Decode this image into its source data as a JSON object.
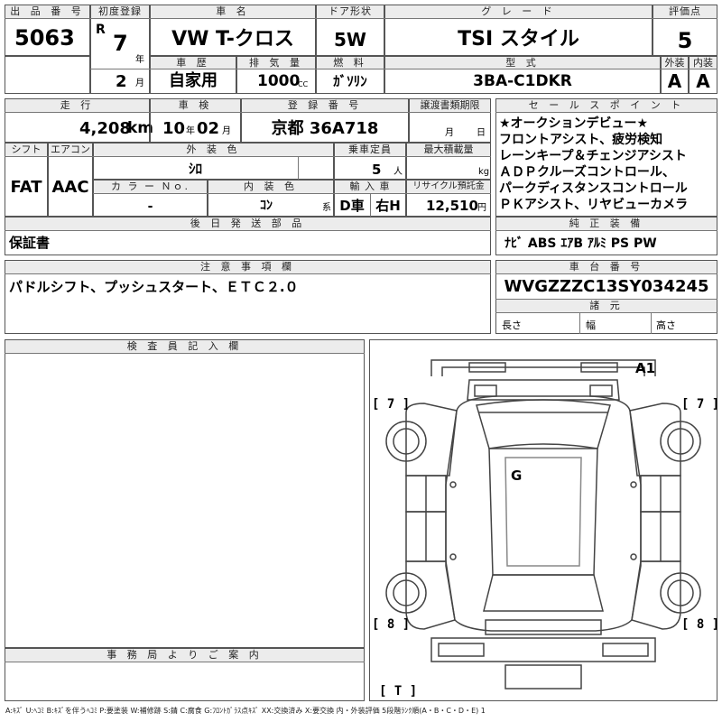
{
  "auction": {
    "lot_label": "出 品 番 号",
    "lot_number": "5063",
    "first_reg_label": "初度登録",
    "era": "R",
    "year": "7",
    "year_unit": "年",
    "month": "2",
    "month_unit": "月",
    "car_name_label": "車 名",
    "car_name": "VW T-クロス",
    "door_label": "ドア形状",
    "door": "5W",
    "grade_label": "グ レ ー ド",
    "grade": "TSI スタイル",
    "score_label": "評価点",
    "score": "5",
    "history_label": "車 歴",
    "history": "自家用",
    "displacement_label": "排 気 量",
    "displacement": "1000",
    "cc": "CC",
    "fuel_label": "燃 料",
    "fuel": "ｶﾞｿﾘﾝ",
    "model_code_label": "型 式",
    "model_code": "3BA-C1DKR",
    "exterior_label": "外装",
    "interior_label": "内装",
    "exterior_grade": "A",
    "interior_grade": "A",
    "mileage_label": "走 行",
    "mileage": "4,208",
    "km": "km",
    "inspection_label": "車 検",
    "inspection_year": "10",
    "inspection_month": "02",
    "year_small": "年",
    "month_small": "月",
    "plate_label": "登 録 番 号",
    "plate": "京都 36A718",
    "transfer_label": "譲渡書類期限",
    "transfer_month": "月",
    "transfer_day": "日",
    "sales_label": "セ ー ル ス ポ イ ン ト",
    "sales_points": [
      "★オークションデビュー★",
      "フロントアシスト、疲労検知",
      "レーンキープ＆チェンジアシスト",
      "ＡＤＰクルーズコントロール、",
      "パークディスタンスコントロール",
      "ＰＫアシスト、リヤビューカメラ"
    ],
    "shift_label": "シフト",
    "shift": "FAT",
    "ac_label": "エアコン",
    "ac": "AAC",
    "ext_color_label": "外 装 色",
    "ext_color": "ｼﾛ",
    "capacity_label": "乗車定員",
    "capacity": "5",
    "capacity_unit": "人",
    "load_label": "最大積載量",
    "load_unit": "kg",
    "color_no_label": "カ ラ ー Ｎｏ.",
    "color_no": "-",
    "int_color_label": "内 装 色",
    "int_color": "ｺﾝ",
    "int_color_unit": "系",
    "import_label": "輸 入 車",
    "import_d": "D車",
    "import_side": "右H",
    "recycle_label": "リサイクル預託金",
    "recycle": "12,510",
    "yen": "円",
    "later_parts_label": "後 日 発 送 部 品",
    "later_parts": "保証書",
    "equipment_label": "純 正 装 備",
    "equipment": "ﾅﾋﾞ ABS ｴｱB ｱﾙﾐ PS PW",
    "notes_label": "注 意 事 項 欄",
    "notes": "パドルシフト、プッシュスタート、ＥＴＣ２.０",
    "vin_label": "車 台 番 号",
    "vin": "WVGZZZC13SY034245",
    "specs_label": "諸 元",
    "length_label": "長さ",
    "width_label": "幅",
    "height_label": "高さ",
    "inspector_label": "検 査 員 記 入 欄",
    "office_label": "事 務 局 よ り ご 案 内",
    "legend": "A:ｷｽﾞ U:ﾍｺﾐ B:ｷｽﾞを伴うﾍｺﾐ P:要塗装 W:補修跡 S:錆 C:腐食 G:ﾌﾛﾝﾄｶﾞﾗｽ点ｷｽﾞ XX:交換済み X:要交換 内・外装評価 5段階ﾗﾝｸ順(A・B・C・D・E) 1"
  },
  "diagram": {
    "marks": {
      "a1": "A1",
      "g": "G",
      "front_left": "[ 7 ]",
      "front_right": "[ 7 ]",
      "rear_left": "[ 8 ]",
      "rear_right": "[ 8 ]",
      "trunk": "[ T ]"
    }
  }
}
